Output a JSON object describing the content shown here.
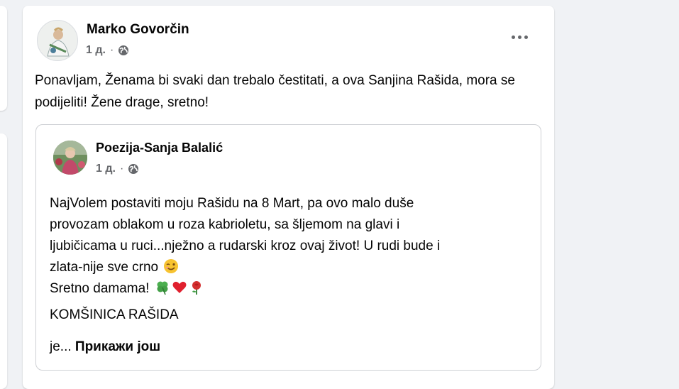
{
  "post": {
    "author": "Marko Govorčin",
    "time": "1 д.",
    "separator": "·",
    "more_icon": "more-horizontal-icon",
    "privacy_icon": "globe-icon",
    "text": "Ponavljam, Ženama bi svaki dan trebalo čestitati, a ova Sanjina Rašida, mora se podijeliti! Žene drage, sretno!"
  },
  "shared": {
    "author": "Poezija-Sanja Balalić",
    "time": "1 д.",
    "separator": "·",
    "lines": [
      "NajVolem postaviti moju Rašidu na 8 Mart, pa ovo malo duše",
      "provozam oblakom u roza kabrioletu, sa šljemom na glavi i",
      "ljubičicama u ruci...nježno a rudarski kroz ovaj život! U rudi bude i",
      "zlata-nije sve crno",
      "Sretno damama!",
      "KOMŠINICA RAŠIDA"
    ],
    "emojis": [
      "winking-face-emoji",
      "four-leaf-clover-emoji",
      "red-heart-emoji",
      "rose-emoji"
    ],
    "truncated_prefix": "je...",
    "see_more": "Прикажи још"
  }
}
